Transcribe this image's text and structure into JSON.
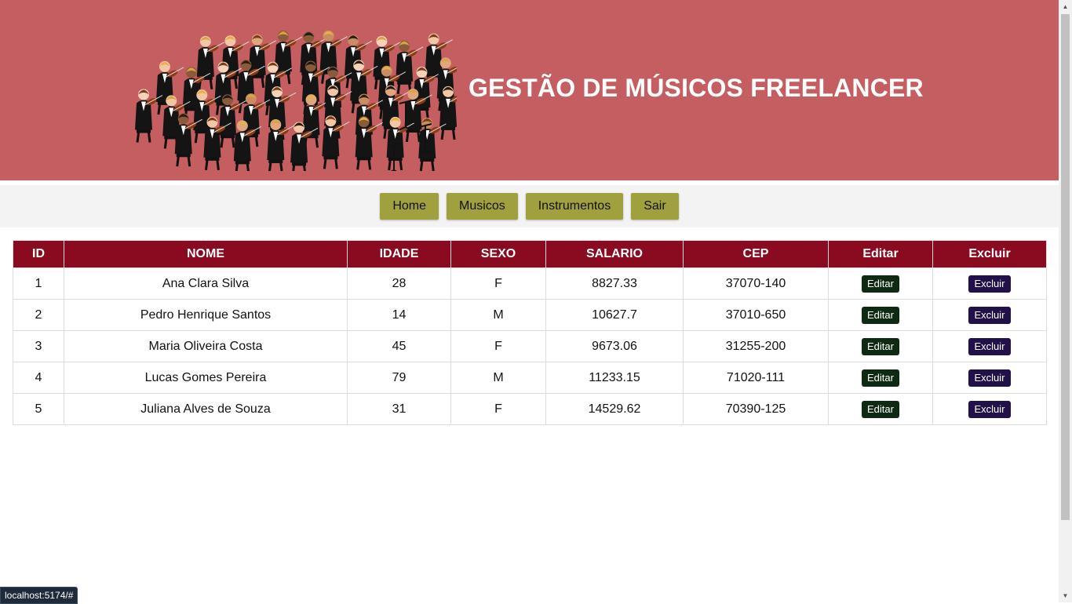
{
  "header": {
    "title": "GESTÃO DE MÚSICOS FREELANCER",
    "image_icon": "orchestra-illustration"
  },
  "nav": {
    "items": [
      "Home",
      "Musicos",
      "Instrumentos",
      "Sair"
    ]
  },
  "table": {
    "columns": [
      "ID",
      "NOME",
      "IDADE",
      "SEXO",
      "SALARIO",
      "CEP",
      "Editar",
      "Excluir"
    ],
    "rows": [
      {
        "id": "1",
        "nome": "Ana Clara Silva",
        "idade": "28",
        "sexo": "F",
        "salario": "8827.33",
        "cep": "37070-140"
      },
      {
        "id": "2",
        "nome": "Pedro Henrique Santos",
        "idade": "14",
        "sexo": "M",
        "salario": "10627.7",
        "cep": "37010-650"
      },
      {
        "id": "3",
        "nome": "Maria Oliveira Costa",
        "idade": "45",
        "sexo": "F",
        "salario": "9673.06",
        "cep": "31255-200"
      },
      {
        "id": "4",
        "nome": "Lucas Gomes Pereira",
        "idade": "79",
        "sexo": "M",
        "salario": "11233.15",
        "cep": "71020-111"
      },
      {
        "id": "5",
        "nome": "Juliana Alves de Souza",
        "idade": "31",
        "sexo": "F",
        "salario": "14529.62",
        "cep": "70390-125"
      }
    ],
    "edit_label": "Editar",
    "delete_label": "Excluir"
  },
  "status_bar": {
    "url": "localhost:5174/#"
  },
  "colors": {
    "header_bg": "#c45e60",
    "nav_button": "#a0a03f",
    "table_header": "#8a0a1f",
    "edit_button": "#0f2a12",
    "delete_button": "#22104a"
  }
}
